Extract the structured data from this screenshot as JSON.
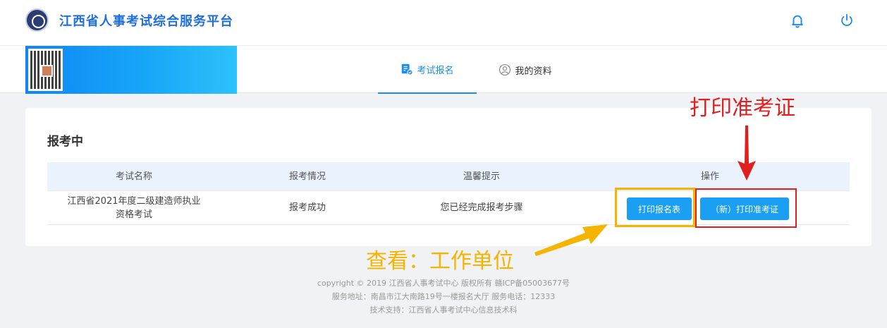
{
  "header": {
    "title": "江西省人事考试综合服务平台",
    "logo_icon": "university-seal-icon",
    "bell_icon": "bell-icon",
    "power_icon": "power-icon"
  },
  "nav": {
    "tabs": [
      {
        "label": "考试报名",
        "icon": "registration-form-icon",
        "active": true
      },
      {
        "label": "我的资料",
        "icon": "user-circle-icon",
        "active": false
      }
    ],
    "accent": "#1a8cf0"
  },
  "card": {
    "title": "报考中",
    "columns": [
      "考试名称",
      "报考情况",
      "温馨提示",
      "操作"
    ],
    "rows": [
      {
        "exam_name_line1": "江西省2021年度二级建造师执业",
        "exam_name_line2": "资格考试",
        "status": "报考成功",
        "tip": "您已经完成报考步骤",
        "actions": [
          "打印报名表",
          "（新）打印准考证"
        ]
      }
    ]
  },
  "annotations": {
    "red_text": "打印准考证",
    "yellow_text": "查看：工作单位",
    "red_color": "#e0201e",
    "yellow_color": "#f5b400"
  },
  "footer": {
    "line1": "copyright © 2019 江西省人事考试中心 版权所有 赣ICP备05003677号",
    "line2": "服务地址：南昌市江大南路19号一楼报名大厅 服务电话：12333",
    "line3": "技术支持：江西省人事考试中心信息技术科"
  }
}
